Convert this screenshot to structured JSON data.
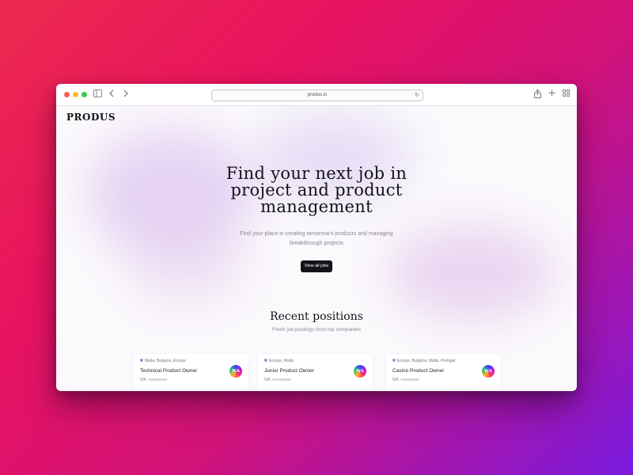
{
  "browser": {
    "url": "produs.io"
  },
  "site": {
    "logo": "PRODUS"
  },
  "hero": {
    "title": "Find your next job in project and product management",
    "subtitle": "Find your place in creating tomorrow's products and managing breakthrough projects",
    "cta_label": "View all jobs"
  },
  "recent": {
    "title": "Recent positions",
    "subtitle": "Fresh job postings from top companies",
    "jobs": [
      {
        "location": "Malta, Bulgaria, Europe",
        "title": "Technical Product Owner",
        "company": "WA",
        "logo_text": "WA"
      },
      {
        "location": "Europe, Malta",
        "title": "Junior Product Owner",
        "company": "WA",
        "logo_text": "WA"
      },
      {
        "location": "Europe, Bulgaria, Malta, Portugal",
        "title": "Casino Product Owner",
        "company": "WA",
        "logo_text": "WA"
      }
    ]
  },
  "icons": {
    "sidebar": "sidebar-icon",
    "back": "chevron-left-icon",
    "forward": "chevron-right-icon",
    "reload": "reload-icon",
    "share": "share-icon",
    "new_tab": "plus-icon",
    "tabs": "grid-icon",
    "location": "location-pin-icon"
  },
  "colors": {
    "background_start": "#ec2a4e",
    "background_end": "#7a1ce0",
    "cta": "#141318"
  }
}
